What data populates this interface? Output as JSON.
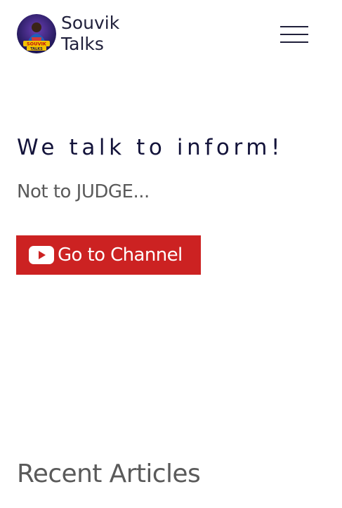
{
  "header": {
    "brand_line1": "Souvik",
    "brand_line2": "Talks",
    "logo_text_top": "SOUVIK",
    "logo_text_bottom": "TALKS",
    "menu_icon": "hamburger-menu-icon"
  },
  "hero": {
    "title": "We talk to inform!",
    "subtitle": "Not to JUDGE...",
    "cta_label": "Go to Channel",
    "cta_icon": "youtube-icon"
  },
  "sections": {
    "recent_articles_title": "Recent Articles"
  },
  "colors": {
    "brand_text": "#1f1f3a",
    "cta_background": "#cc2222",
    "muted_text": "#5a5a5a"
  }
}
